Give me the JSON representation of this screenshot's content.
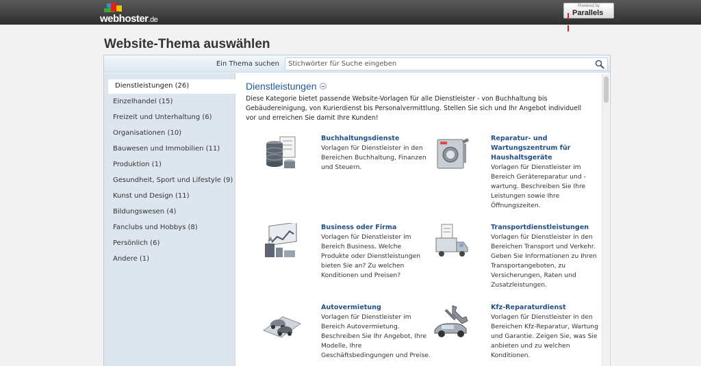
{
  "brand": {
    "logo_text": "webhoster",
    "logo_tld": ".de",
    "powered_by": "Powered by",
    "partner": "Parallels"
  },
  "page": {
    "title": "Website-Thema auswählen"
  },
  "search": {
    "label": "Ein Thema suchen",
    "placeholder": "Stichwörter für Suche eingeben"
  },
  "categories": [
    {
      "label": "Dienstleistungen (26)",
      "active": true
    },
    {
      "label": "Einzelhandel (15)"
    },
    {
      "label": "Freizeit und Unterhaltung (6)"
    },
    {
      "label": "Organisationen (10)"
    },
    {
      "label": "Bauwesen und Immobilien (11)"
    },
    {
      "label": "Produktion (1)"
    },
    {
      "label": "Gesundheit, Sport und Lifestyle (9)"
    },
    {
      "label": "Kunst und Design (11)"
    },
    {
      "label": "Bildungswesen (4)"
    },
    {
      "label": "Fanclubs und Hobbys (8)"
    },
    {
      "label": "Persönlich (6)"
    },
    {
      "label": "Andere (1)"
    }
  ],
  "section": {
    "title": "Dienstleistungen",
    "description": "Diese Kategorie bietet passende Website-Vorlagen für alle Dienstleister - von Buchhaltung bis Gebäudereinigung, von Kurierdienst bis Personalvermittlung. Stellen Sie sich und Ihr Angebot individuell vor und erreichen Sie damit Ihre Kunden!"
  },
  "templates": [
    {
      "name": "Buchhaltungsdienste",
      "icon": "accounting-icon",
      "description": "Vorlagen für Dienstleister in den Bereichen Buchhaltung, Finanzen und Steuern."
    },
    {
      "name": "Reparatur- und Wartungszentrum für Haushaltsgeräte",
      "icon": "appliance-repair-icon",
      "description": "Vorlagen für Dienstleister im Bereich Gerätereparatur und -wartung. Beschreiben Sie Ihre Leistungen sowie Ihre Öffnungszeiten."
    },
    {
      "name": "Business oder Firma",
      "icon": "business-icon",
      "description": "Vorlagen für Dienstleister im Bereich Business. Welche Produkte oder Dienstleistungen bieten Sie an? Zu welchen Konditionen und Preisen?"
    },
    {
      "name": "Transportdienstleistungen",
      "icon": "transport-icon",
      "description": "Vorlagen für Dienstleister in den Bereichen Transport und Verkehr. Geben Sie Informationen zu Ihren Transportangeboten, zu Versicherungen, Raten und Zusatzleistungen."
    },
    {
      "name": "Autovermietung",
      "icon": "car-rental-icon",
      "description": "Vorlagen für Dienstleister im Bereich Autovermietung. Beschreiben Sie Ihr Angebot, Ihre Modelle, Ihre Geschäftsbedingungen und Preise."
    },
    {
      "name": "Kfz-Reparaturdienst",
      "icon": "car-repair-icon",
      "description": "Vorlagen für Dienstleister in den Bereichen Kfz-Reparatur, Wartung und Garantie. Zeigen Sie, was Sie anbieten und zu welchen Konditionen."
    }
  ]
}
